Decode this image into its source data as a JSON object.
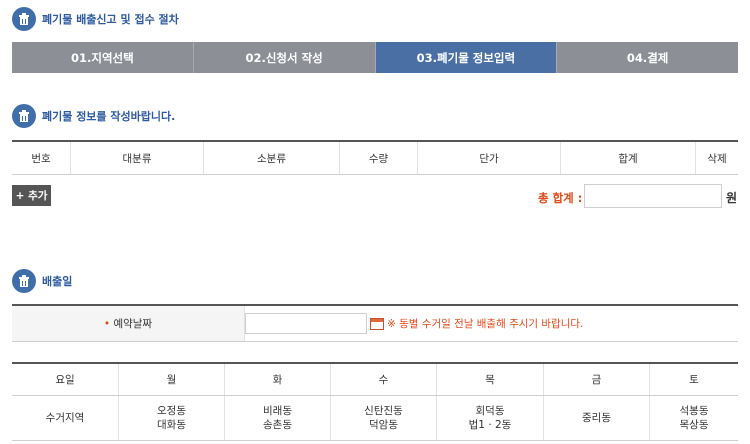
{
  "header": {
    "title": "폐기물 배출신고 및 접수 절차"
  },
  "steps": [
    {
      "label": "01.지역선택"
    },
    {
      "label": "02.신청서 작성"
    },
    {
      "label": "03.폐기물 정보입력"
    },
    {
      "label": "04.결제"
    }
  ],
  "waste_info": {
    "title": "폐기물 정보를 작성바랍니다.",
    "columns": [
      "번호",
      "대분류",
      "소분류",
      "수량",
      "단가",
      "합계",
      "삭제"
    ],
    "add_button": "+ 추가",
    "total_label": "총 합계 :",
    "total_value": "",
    "total_unit": "원"
  },
  "discharge": {
    "title": "배출일",
    "required_mark": "•",
    "date_label": "예약날짜",
    "date_value": "",
    "notice": "※ 동별 수거일 전날 배출해 주시기 바랍니다."
  },
  "schedule": {
    "header_label": "요일",
    "days": [
      "월",
      "화",
      "수",
      "목",
      "금",
      "토"
    ],
    "row_label": "수거지역",
    "areas": [
      [
        "오정동",
        "대화동"
      ],
      [
        "비래동",
        "송촌동"
      ],
      [
        "신탄진동",
        "덕암동"
      ],
      [
        "회덕동",
        "법1 · 2동"
      ],
      [
        "중리동"
      ],
      [
        "석봉동",
        "목상동"
      ]
    ]
  },
  "colors": {
    "accent": "#4a6fa5",
    "step_inactive": "#8c9096",
    "warning": "#e04a1a",
    "title": "#2d5aa0"
  }
}
